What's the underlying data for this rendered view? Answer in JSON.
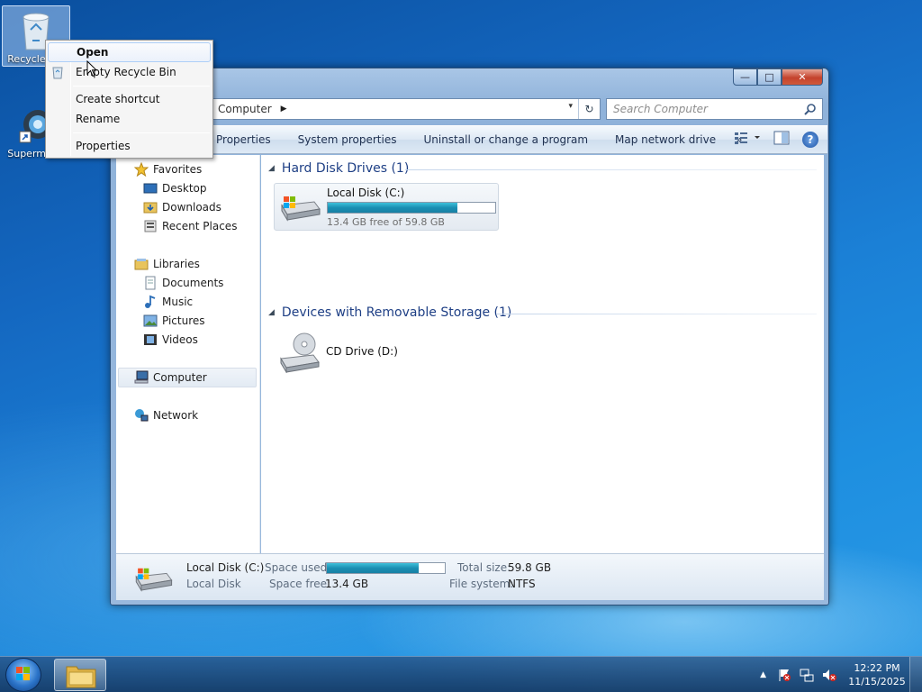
{
  "desktop": {
    "icons": [
      {
        "label": "Recycle Bin",
        "icon": "recycle-bin-icon"
      },
      {
        "label": "Supermium",
        "icon": "supermium-icon"
      }
    ]
  },
  "context_menu": {
    "items": [
      "Open",
      "Empty Recycle Bin",
      "Create shortcut",
      "Rename",
      "Properties"
    ]
  },
  "window": {
    "address": {
      "location": "Computer",
      "dropdown_glyph": "▾",
      "refresh_glyph": "↻"
    },
    "search": {
      "placeholder": "Search Computer"
    },
    "caption": {
      "minimize": "—",
      "maximize": "□",
      "close": "✕"
    },
    "toolbar": {
      "properties": "Properties",
      "system_properties": "System properties",
      "uninstall": "Uninstall or change a program",
      "map_drive": "Map network drive",
      "more": "»",
      "help": "?"
    },
    "nav": {
      "favorites": "Favorites",
      "desktop": "Desktop",
      "downloads": "Downloads",
      "recent_places": "Recent Places",
      "libraries": "Libraries",
      "documents": "Documents",
      "music": "Music",
      "pictures": "Pictures",
      "videos": "Videos",
      "computer": "Computer",
      "network": "Network"
    },
    "groups": {
      "hdd": {
        "title": "Hard Disk Drives (1)",
        "drive_name": "Local Disk (C:)",
        "drive_free": "13.4 GB free of 59.8 GB",
        "used_fraction": 0.776
      },
      "removable": {
        "title": "Devices with Removable Storage (1)",
        "drive_name": "CD Drive (D:)"
      }
    },
    "details": {
      "name": "Local Disk (C:)",
      "type": "Local Disk",
      "space_used_label": "Space used:",
      "space_free_label": "Space free:",
      "space_free_value": "13.4 GB",
      "total_size_label": "Total size:",
      "total_size_value": "59.8 GB",
      "file_system_label": "File system:",
      "file_system_value": "NTFS",
      "used_fraction": 0.776
    }
  },
  "taskbar": {
    "time": "12:22 PM",
    "date": "11/15/2025",
    "tray_arrow": "▲"
  }
}
